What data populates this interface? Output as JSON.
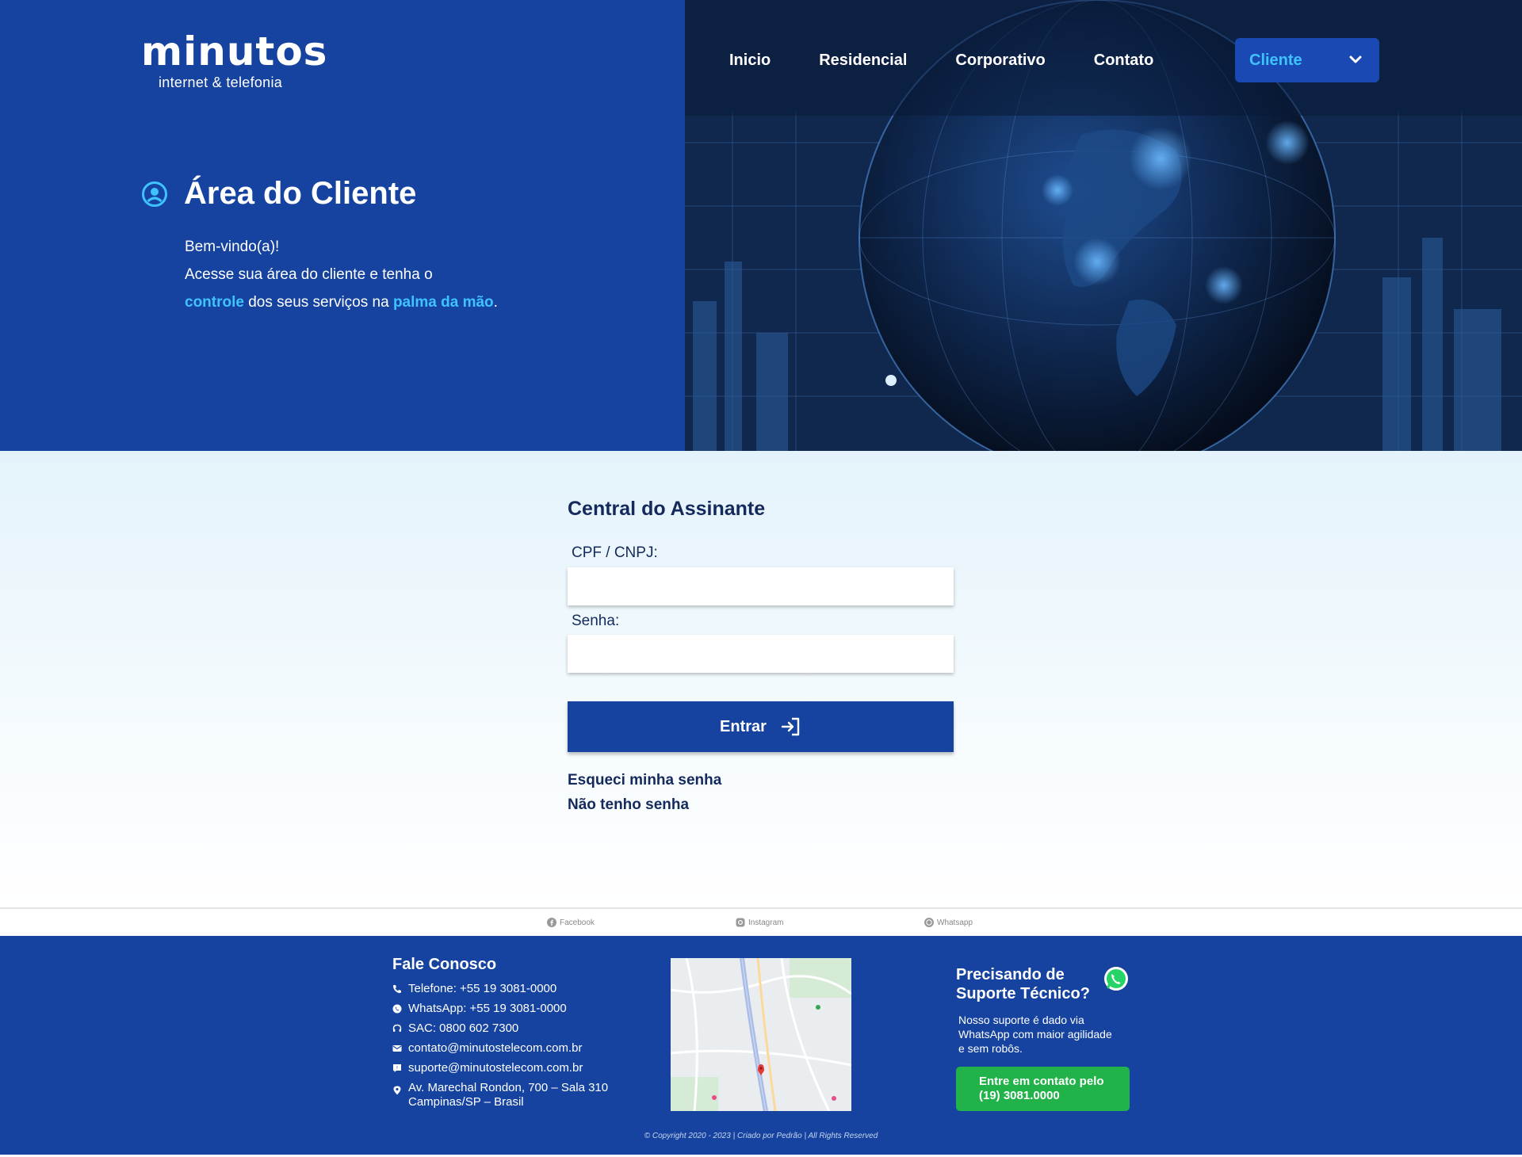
{
  "brand": {
    "logo_word": "minutos",
    "logo_tagline": "internet & telefonia"
  },
  "nav": {
    "items": [
      "Inicio",
      "Residencial",
      "Corporativo",
      "Contato"
    ],
    "cliente_label": "Cliente"
  },
  "hero": {
    "title": "Área do Cliente",
    "line1": "Bem-vindo(a)!",
    "line2": "Acesse sua área do cliente e tenha o",
    "line3_hl1": "controle",
    "line3_mid": " dos seus serviços na ",
    "line3_hl2": "palma da mão",
    "line3_end": "."
  },
  "login": {
    "title": "Central do Assinante",
    "cpf_label": "CPF / CNPJ:",
    "cpf_value": "",
    "senha_label": "Senha:",
    "senha_value": "",
    "submit_label": "Entrar",
    "forgot_link": "Esqueci minha senha",
    "no_password_link": "Não tenho senha"
  },
  "social": {
    "facebook": "Facebook",
    "instagram": "Instagram",
    "whatsapp": "Whatsapp"
  },
  "footer": {
    "contact_title": "Fale Conosco",
    "telefone": "Telefone: +55 19 3081-0000",
    "whatsapp": "WhatsApp: +55 19 3081-0000",
    "sac": "SAC: 0800 602 7300",
    "email_contato": "contato@minutostelecom.com.br",
    "email_suporte": "suporte@minutostelecom.com.br",
    "address_line1": "Av. Marechal Rondon, 700 – Sala 310",
    "address_line2": "Campinas/SP – Brasil",
    "support_title_line1": "Precisando de",
    "support_title_line2": "Suporte Técnico?",
    "support_text": "Nosso suporte é dado via WhatsApp com maior agilidade e sem robôs.",
    "support_btn_line1": "Entre em contato pelo",
    "support_btn_line2": "(19) 3081.0000",
    "copyright": "© Copyright 2020 - 2023 | Criado por Pedrão | All Rights Reserved"
  },
  "colors": {
    "primary": "#15439f",
    "accent": "#3fc3ff",
    "text_dark": "#142a5c",
    "whatsapp_green": "#21b34a"
  }
}
